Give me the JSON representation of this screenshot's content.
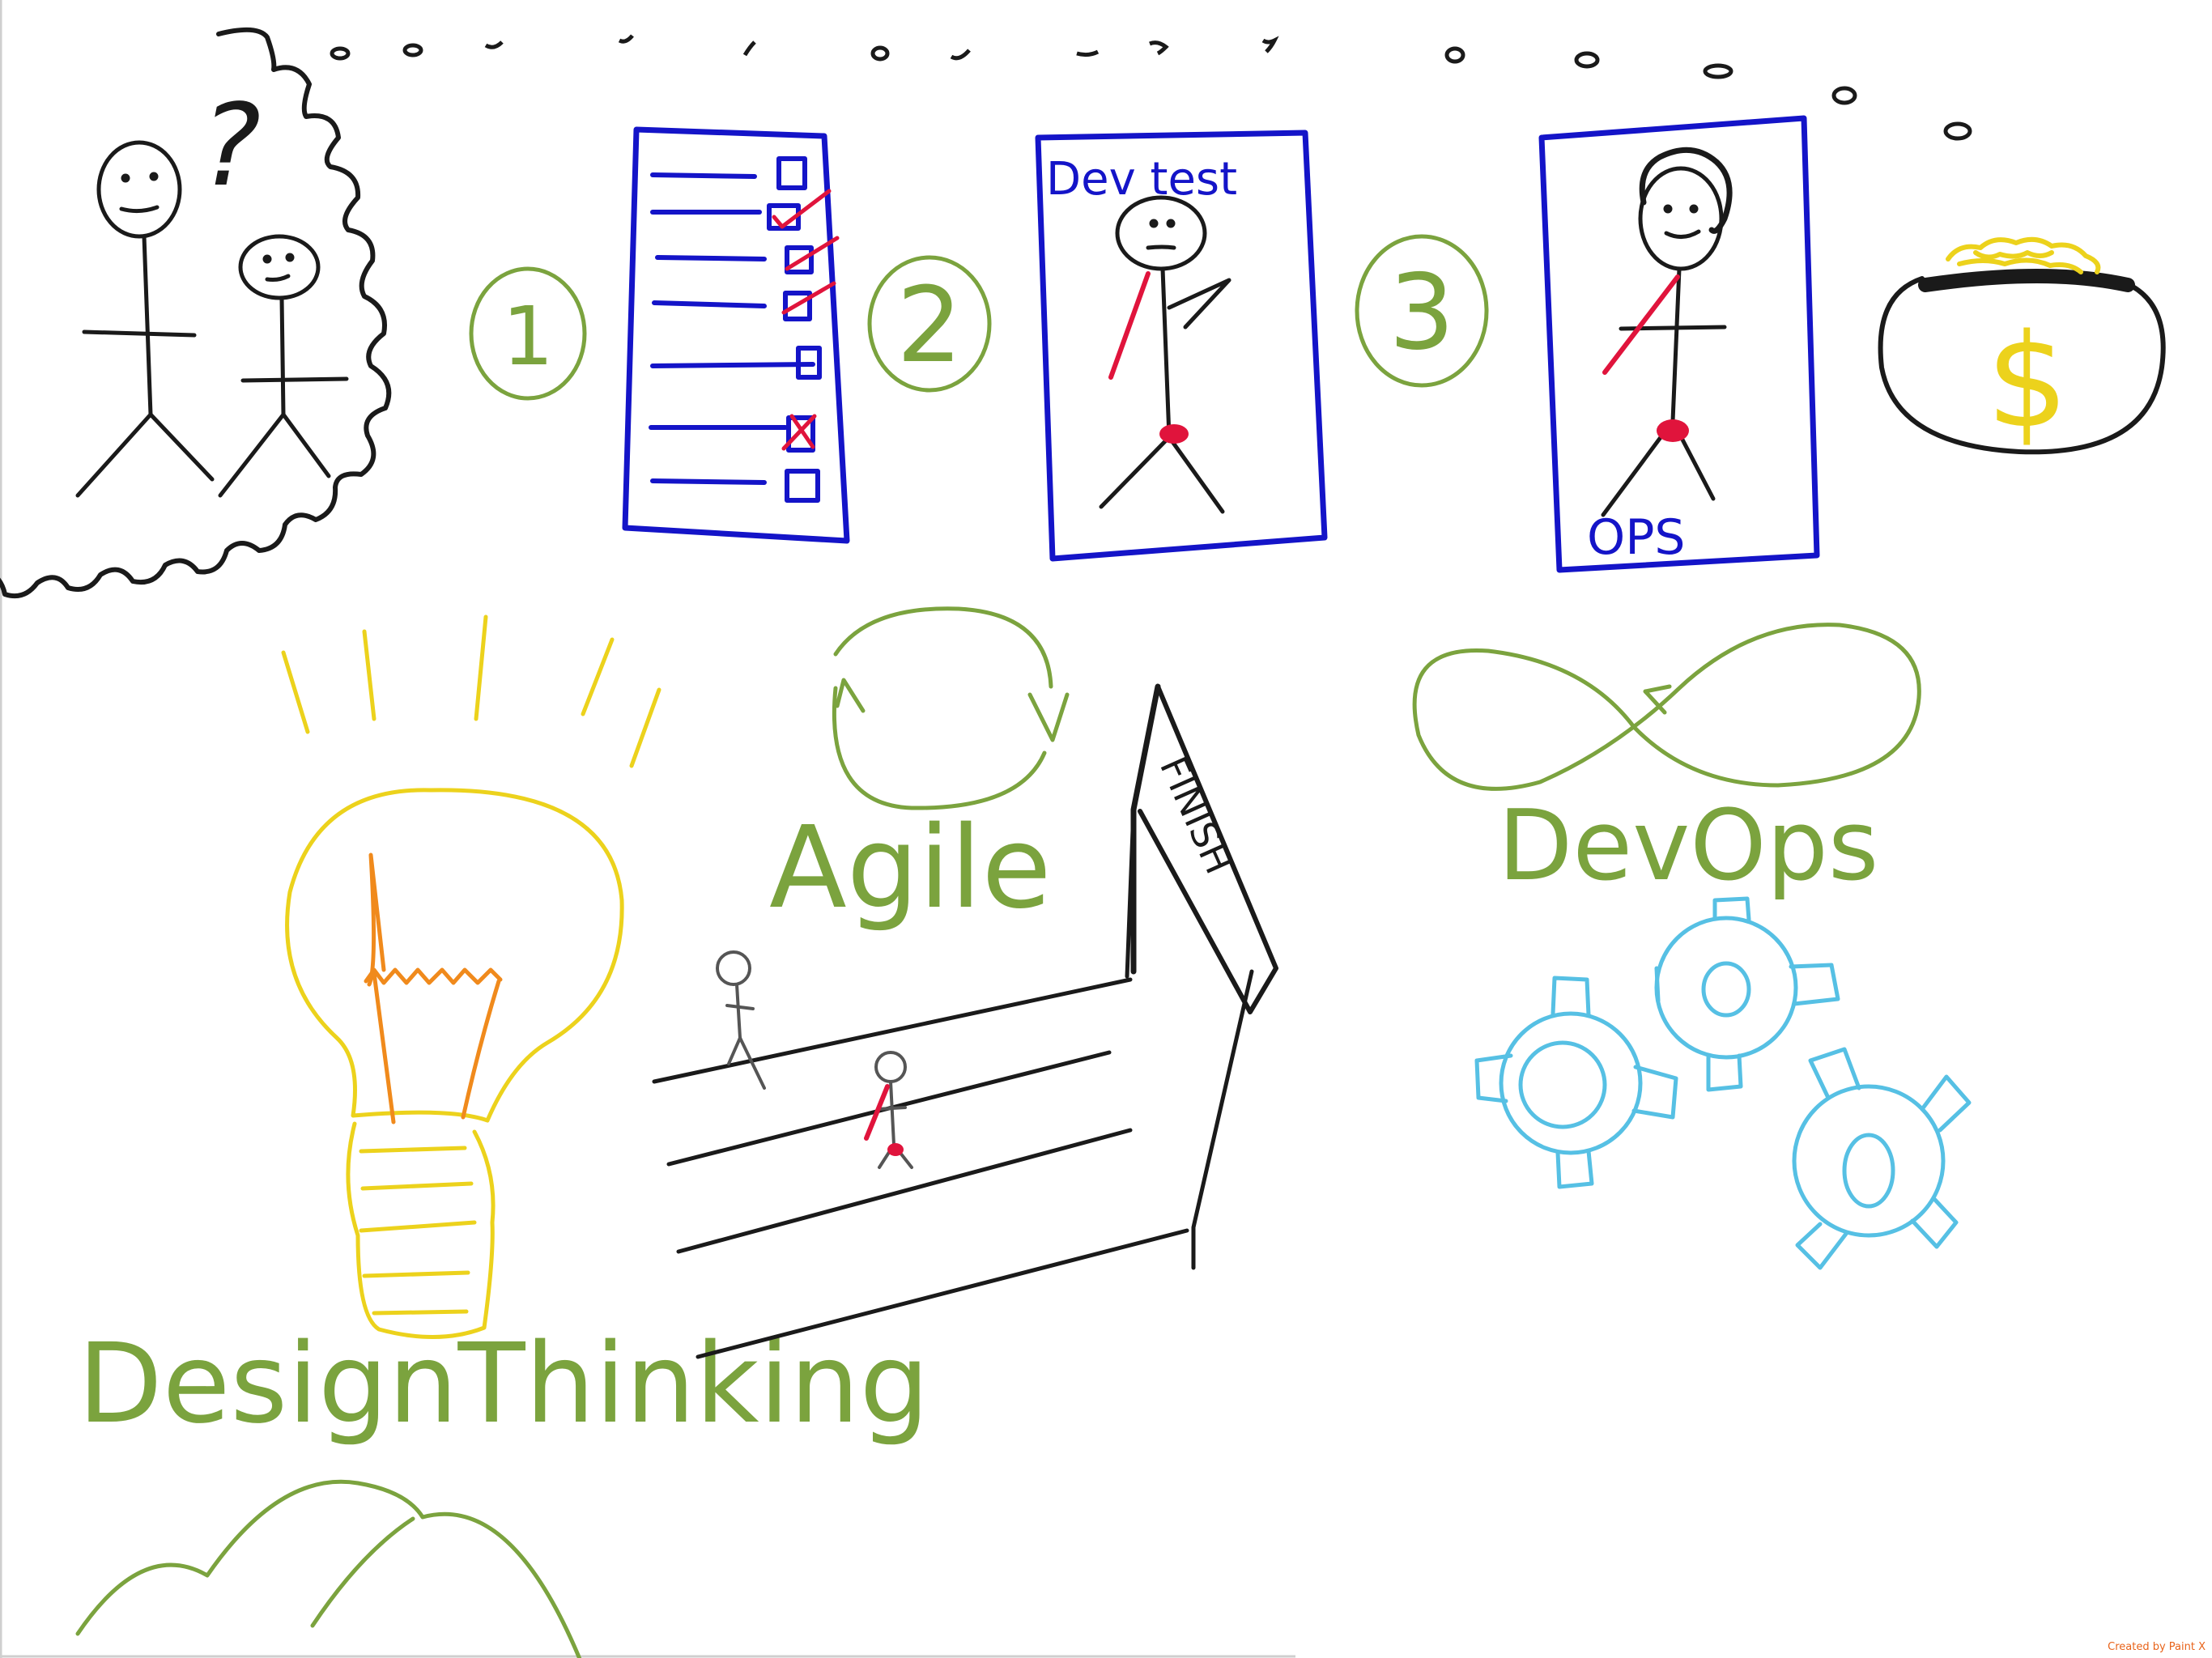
{
  "texts": {
    "step_1": "1",
    "step_2": "2",
    "step_3": "3",
    "dev_test": "Dev test",
    "ops": "OPS",
    "question_mark": "?",
    "dollar": "$",
    "finish": "FINISH",
    "agile": "Agile",
    "devops": "DevOps",
    "design_thinking": "DesignThinking",
    "watermark": "Created by Paint X"
  },
  "colors": {
    "black": "#1a1a1a",
    "blue": "#1414c8",
    "green": "#7ba33e",
    "red": "#e0143c",
    "yellow": "#ecd21c",
    "orange": "#f08a1c",
    "cyan": "#56c0e4",
    "watermark": "#e8631a"
  },
  "icons": [
    "question-mark-icon",
    "checklist-icon",
    "money-pot-icon",
    "light-bulb-icon",
    "cycle-arrows-icon",
    "infinity-loop-icon",
    "gear-icon",
    "finish-flag-icon",
    "mountains-icon"
  ]
}
